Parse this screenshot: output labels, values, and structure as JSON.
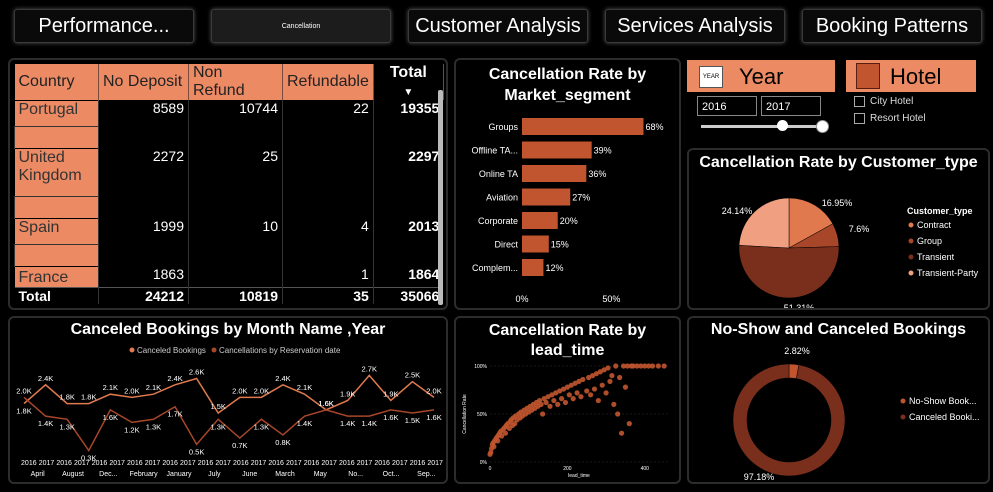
{
  "tabs": [
    {
      "label": "Performance..."
    },
    {
      "label": "Cancellation"
    },
    {
      "label": "Customer Analysis"
    },
    {
      "label": "Services Analysis"
    },
    {
      "label": "Booking Patterns"
    }
  ],
  "matrix": {
    "headers": [
      "Country",
      "No Deposit",
      "Non Refund",
      "Refundable",
      "Total"
    ],
    "rows": [
      {
        "country": "Portugal",
        "no_deposit": "8589",
        "non_refund": "10744",
        "refundable": "22",
        "total": "19355"
      },
      {
        "country": "United Kingdom",
        "no_deposit": "2272",
        "non_refund": "25",
        "refundable": "",
        "total": "2297"
      },
      {
        "country": "Spain",
        "no_deposit": "1999",
        "non_refund": "10",
        "refundable": "4",
        "total": "2013"
      },
      {
        "country": "France",
        "no_deposit": "1863",
        "non_refund": "",
        "refundable": "1",
        "total": "1864"
      }
    ],
    "total_row": {
      "label": "Total",
      "no_deposit": "24212",
      "non_refund": "10819",
      "refundable": "35",
      "total": "35066"
    }
  },
  "market_segment_chart": {
    "title": "Cancellation Rate by Market_segment",
    "x_ticks": [
      "0%",
      "50%"
    ]
  },
  "year_slicer": {
    "title": "Year",
    "icon_text": "YEAR",
    "from": "2016",
    "to": "2017"
  },
  "hotel_slicer": {
    "title": "Hotel",
    "options": [
      "City Hotel",
      "Resort Hotel"
    ]
  },
  "customer_type_chart": {
    "title": "Cancellation Rate by Customer_type",
    "legend_title": "Customer_type"
  },
  "month_chart": {
    "title": "Canceled Bookings by Month Name ,Year",
    "legend": [
      "Canceled Bookings",
      "Cancellations by Reservation date"
    ]
  },
  "lead_time_chart": {
    "title": "Cancellation Rate by lead_time",
    "y_label": "Cancellation Rate",
    "x_label": "lead_time",
    "y_ticks": [
      "100%",
      "50%",
      "0%"
    ],
    "x_ticks": [
      "0",
      "200",
      "400"
    ]
  },
  "noshow_chart": {
    "title": "No-Show and Canceled Bookings"
  },
  "colors": {
    "accent": "#ec8a64",
    "bar": "#c0552f",
    "dark": "#7a2f1c",
    "light": "#f0a080"
  },
  "chart_data": [
    {
      "type": "bar",
      "title": "Cancellation Rate by Market_segment",
      "categories": [
        "Groups",
        "Offline TA...",
        "Online TA",
        "Aviation",
        "Corporate",
        "Direct",
        "Complem..."
      ],
      "values": [
        68,
        39,
        36,
        27,
        20,
        15,
        12
      ],
      "labels": [
        "68%",
        "39%",
        "36%",
        "27%",
        "20%",
        "15%",
        "12%"
      ],
      "xlim": [
        0,
        75
      ],
      "orientation": "horizontal"
    },
    {
      "type": "pie",
      "title": "Cancellation Rate by Customer_type",
      "categories": [
        "Contract",
        "Group",
        "Transient",
        "Transient-Party"
      ],
      "values": [
        16.95,
        7.6,
        51.31,
        24.14
      ],
      "labels": [
        "16.95%",
        "7.6%",
        "51.31%",
        "24.14%"
      ],
      "colors": [
        "#e07a4e",
        "#a8462a",
        "#7a2f1c",
        "#f0a080"
      ],
      "legend": "right"
    },
    {
      "type": "line",
      "title": "Canceled Bookings by Month Name ,Year",
      "categories": [
        "April 2016",
        "April 2017",
        "August 2016",
        "August 2017",
        "Dec... 2016",
        "Dec... 2017",
        "February 2016",
        "February 2017",
        "January 2016",
        "January 2017",
        "July 2016",
        "July 2017",
        "June 2016",
        "June 2017",
        "March 2016",
        "March 2017",
        "May 2016",
        "May 2017",
        "No... 2016",
        "No... 2017",
        "Oct... 2016",
        "Oct... 2017",
        "Sep... 2016",
        "Sep... 2017"
      ],
      "x_years": [
        "2016",
        "2017",
        "2016",
        "2017",
        "2016",
        "2017",
        "2016",
        "2017",
        "2016",
        "2017",
        "2016",
        "2017",
        "2016",
        "2017",
        "2016",
        "2017",
        "2016",
        "2017",
        "2016",
        "2017",
        "2016",
        "2017",
        "2016",
        "2017"
      ],
      "x_months": [
        "April",
        "August",
        "Dec...",
        "February",
        "January",
        "July",
        "June",
        "March",
        "May",
        "No...",
        "Oct...",
        "Sep..."
      ],
      "series": [
        {
          "name": "Canceled Bookings",
          "values": [
            1.8,
            2.4,
            1.8,
            1.8,
            2.1,
            2.0,
            2.1,
            2.4,
            2.6,
            1.5,
            2.0,
            2.0,
            2.4,
            2.1,
            1.6,
            1.9,
            2.7,
            1.9,
            2.5,
            2.0
          ],
          "labels": [
            "1.8K",
            "2.4K",
            "1.8K",
            "1.8K",
            "2.1K",
            "2.0K",
            "2.1K",
            "2.4K",
            "2.6K",
            "1.5K",
            "2.0K",
            "2.0K",
            "2.4K",
            "2.1K",
            "1.6K",
            "1.9K",
            "2.7K",
            "1.9K",
            "2.5K",
            "2.0K"
          ]
        },
        {
          "name": "Cancellations by Reservation date",
          "values": [
            2.0,
            1.4,
            1.3,
            0.3,
            1.6,
            1.2,
            1.3,
            1.7,
            0.5,
            1.3,
            0.7,
            1.3,
            0.8,
            1.4,
            1.6,
            1.4,
            1.4,
            1.6,
            1.5,
            1.6
          ],
          "labels": [
            "2.0K",
            "1.4K",
            "1.3K",
            "0.3K",
            "1.6K",
            "1.2K",
            "1.3K",
            "1.7K",
            "0.5K",
            "1.3K",
            "0.7K",
            "1.3K",
            "0.8K",
            "1.4K",
            "1.6K",
            "1.4K",
            "1.4K",
            "1.6K",
            "1.5K",
            "1.6K"
          ]
        }
      ],
      "ylim": [
        0,
        3
      ]
    },
    {
      "type": "scatter",
      "title": "Cancellation Rate by lead_time",
      "xlabel": "lead_time",
      "ylabel": "Cancellation Rate",
      "xlim": [
        0,
        460
      ],
      "ylim": [
        0,
        100
      ],
      "points": [
        [
          0,
          8
        ],
        [
          2,
          10
        ],
        [
          4,
          14
        ],
        [
          6,
          18
        ],
        [
          8,
          20
        ],
        [
          10,
          16
        ],
        [
          12,
          22
        ],
        [
          15,
          24
        ],
        [
          18,
          26
        ],
        [
          20,
          22
        ],
        [
          22,
          28
        ],
        [
          25,
          30
        ],
        [
          28,
          32
        ],
        [
          30,
          27
        ],
        [
          34,
          34
        ],
        [
          38,
          36
        ],
        [
          40,
          30
        ],
        [
          42,
          38
        ],
        [
          46,
          40
        ],
        [
          50,
          35
        ],
        [
          52,
          42
        ],
        [
          55,
          44
        ],
        [
          58,
          38
        ],
        [
          60,
          46
        ],
        [
          64,
          40
        ],
        [
          66,
          48
        ],
        [
          70,
          44
        ],
        [
          74,
          50
        ],
        [
          78,
          46
        ],
        [
          80,
          52
        ],
        [
          84,
          48
        ],
        [
          88,
          54
        ],
        [
          92,
          50
        ],
        [
          96,
          56
        ],
        [
          100,
          52
        ],
        [
          104,
          58
        ],
        [
          108,
          54
        ],
        [
          112,
          60
        ],
        [
          116,
          56
        ],
        [
          120,
          62
        ],
        [
          124,
          58
        ],
        [
          128,
          64
        ],
        [
          132,
          60
        ],
        [
          136,
          50
        ],
        [
          140,
          66
        ],
        [
          145,
          62
        ],
        [
          150,
          68
        ],
        [
          155,
          58
        ],
        [
          160,
          70
        ],
        [
          165,
          64
        ],
        [
          170,
          72
        ],
        [
          175,
          60
        ],
        [
          180,
          74
        ],
        [
          185,
          66
        ],
        [
          190,
          76
        ],
        [
          195,
          62
        ],
        [
          200,
          78
        ],
        [
          205,
          70
        ],
        [
          210,
          80
        ],
        [
          215,
          66
        ],
        [
          220,
          82
        ],
        [
          225,
          72
        ],
        [
          230,
          84
        ],
        [
          235,
          68
        ],
        [
          240,
          86
        ],
        [
          250,
          74
        ],
        [
          255,
          88
        ],
        [
          260,
          70
        ],
        [
          265,
          90
        ],
        [
          270,
          76
        ],
        [
          275,
          92
        ],
        [
          280,
          64
        ],
        [
          285,
          94
        ],
        [
          290,
          80
        ],
        [
          295,
          96
        ],
        [
          300,
          72
        ],
        [
          305,
          98
        ],
        [
          310,
          84
        ],
        [
          315,
          90
        ],
        [
          320,
          60
        ],
        [
          325,
          100
        ],
        [
          330,
          50
        ],
        [
          335,
          88
        ],
        [
          340,
          30
        ],
        [
          345,
          100
        ],
        [
          350,
          78
        ],
        [
          355,
          100
        ],
        [
          360,
          40
        ],
        [
          365,
          100
        ],
        [
          370,
          100
        ],
        [
          380,
          100
        ],
        [
          390,
          100
        ],
        [
          400,
          100
        ],
        [
          410,
          100
        ],
        [
          420,
          100
        ],
        [
          435,
          100
        ],
        [
          450,
          100
        ]
      ]
    },
    {
      "type": "pie",
      "title": "No-Show and Canceled Bookings",
      "categories": [
        "No-Show Book...",
        "Canceled Booki..."
      ],
      "values": [
        2.82,
        97.18
      ],
      "labels": [
        "2.82%",
        "97.18%"
      ],
      "colors": [
        "#c0552f",
        "#7a2f1c"
      ],
      "legend": "right"
    }
  ]
}
